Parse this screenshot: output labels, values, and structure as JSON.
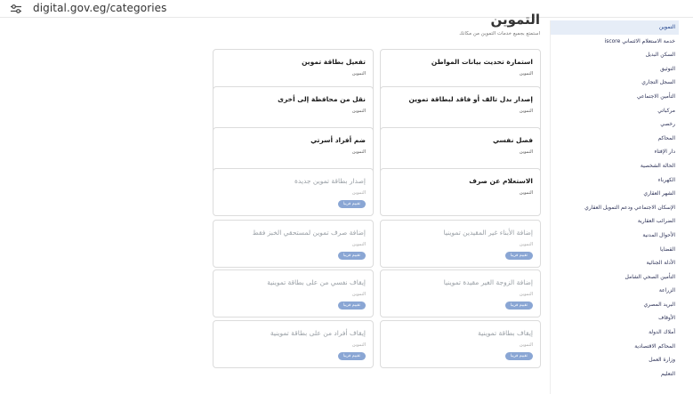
{
  "browser": {
    "url": "digital.gov.eg/categories"
  },
  "header": {
    "title": "التموين",
    "subtitle": "استمتع بجميع خدمات التموين من مكانك"
  },
  "sidebar": {
    "items": [
      "التموين",
      "خدمة الاستعلام الائتماني iscore",
      "السكن البديل",
      "التوثيق",
      "السجل التجاري",
      "التأمين الاجتماعي",
      "مركباتي",
      "رخصي",
      "المحاكم",
      "دار الإفتاء",
      "الحالة الشخصية",
      "الكهرباء",
      "الشهر العقاري",
      "الإسكان الاجتماعي ودعم التمويل العقاري",
      "الضرائب العقارية",
      "الأحوال المدنية",
      "القضايا",
      "الأدلة الجنائية",
      "التأمين الصحي الشامل",
      "الزراعة",
      "البريد المصري",
      "الأوقاف",
      "أملاك الدولة",
      "المحاكم الاقتصادية",
      "وزارة العمل",
      "التعليم"
    ]
  },
  "cards": [
    {
      "title": "استمارة تحديث بيانات المواطن",
      "category": "التموين",
      "soon": false
    },
    {
      "title": "تفعيل بطاقة تموين",
      "category": "التموين",
      "soon": false
    },
    {
      "title": "إصدار بدل تالف أو فاقد لبطاقة تموين",
      "category": "التموين",
      "soon": false
    },
    {
      "title": "نقل من محافظة إلى أخرى",
      "category": "التموين",
      "soon": false
    },
    {
      "title": "فصل نفسي",
      "category": "التموين",
      "soon": false
    },
    {
      "title": "ضم أفراد أسرتي",
      "category": "التموين",
      "soon": false
    },
    {
      "title": "الاستعلام عن صرف",
      "category": "التموين",
      "soon": false
    },
    {
      "title": "إصدار بطاقة تموين جديدة",
      "category": "التموين",
      "soon": true,
      "badge": "تقييم قريبا"
    },
    {
      "title": "إضافة الأبناء غير المقيدين تموينيا",
      "category": "التموين",
      "soon": true,
      "badge": "تقييم قريبا"
    },
    {
      "title": "إضافة صرف تموين لمستحقي الخبز فقط",
      "category": "التموين",
      "soon": true,
      "badge": "تقييم قريبا"
    },
    {
      "title": "إضافة الزوجة الغير مقيدة تموينيا",
      "category": "التموين",
      "soon": true,
      "badge": "تقييم قريبا"
    },
    {
      "title": "إيقاف نفسي من على بطاقة تموينية",
      "category": "التموين",
      "soon": true,
      "badge": "تقييم قريبا"
    },
    {
      "title": "إيقاف بطاقة تموينية",
      "category": "التموين",
      "soon": true,
      "badge": "تقييم قريبا"
    },
    {
      "title": "إيقاف أفراد من على بطاقة تموينية",
      "category": "التموين",
      "soon": true,
      "badge": "تقييم قريبا"
    }
  ]
}
